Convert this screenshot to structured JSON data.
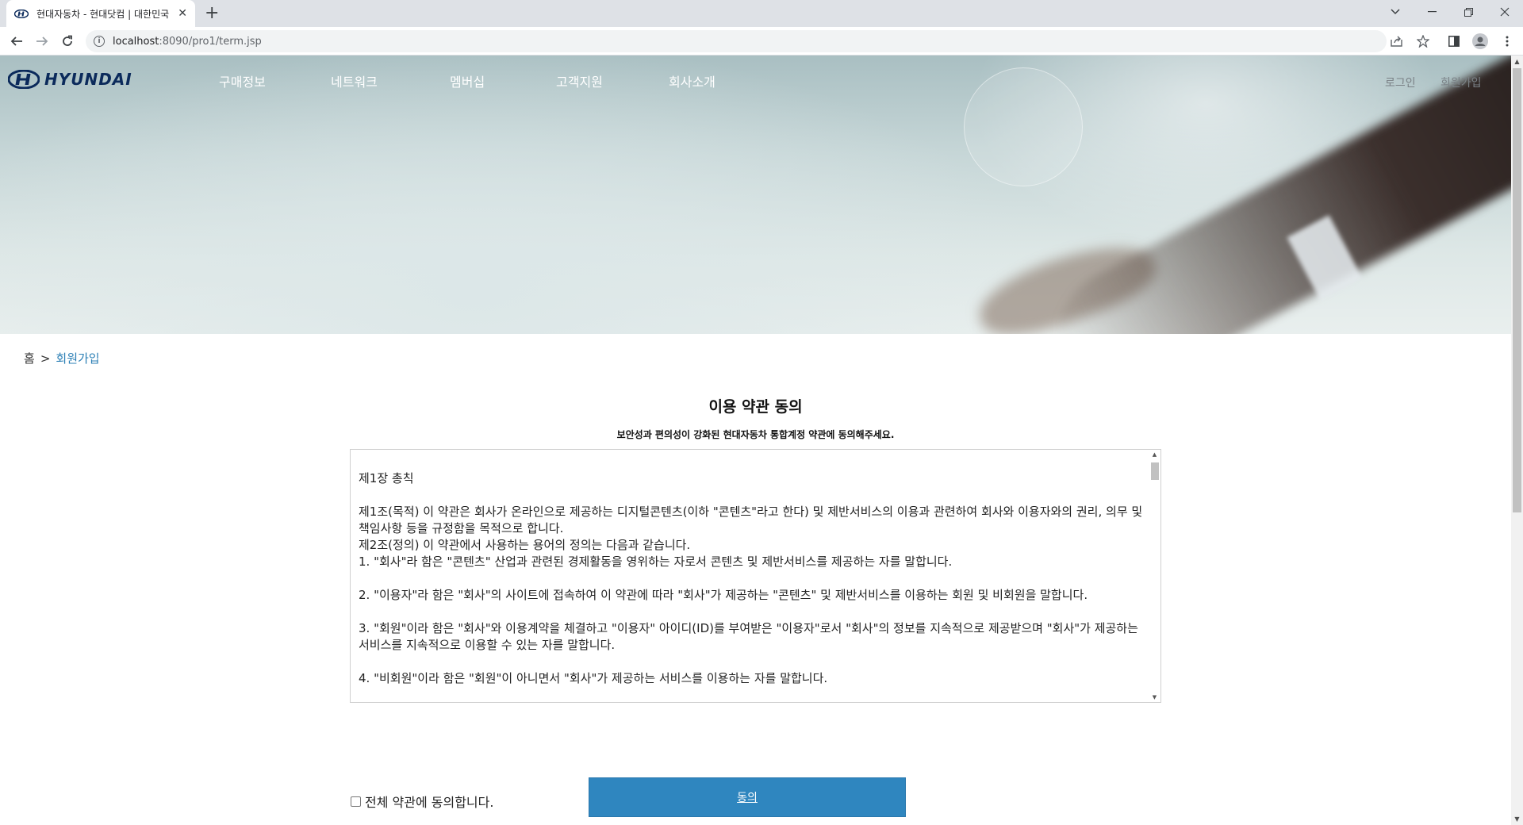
{
  "browser": {
    "tab_title": "현대자동차 - 현대닷컴 | 대한민국",
    "tab_close_glyph": "✕",
    "new_tab_glyph": "+",
    "url_host": "localhost",
    "url_rest": ":8090/pro1/term.jsp"
  },
  "header": {
    "logo_text": "HYUNDAI",
    "nav": [
      "구매정보",
      "네트워크",
      "멤버십",
      "고객지원",
      "회사소개"
    ],
    "login": "로그인",
    "signup": "회원가입"
  },
  "breadcrumb": {
    "home": "홈",
    "separator": ">",
    "current": "회원가입"
  },
  "main": {
    "title": "이용 약관 동의",
    "subtitle": "보안성과 편의성이 강화된 현대자동차 통합계정 약관에 동의해주세요.",
    "terms_text": "제1장 총칙\n\n제1조(목적) 이 약관은 회사가 온라인으로 제공하는 디지털콘텐츠(이하 \"콘텐츠\"라고 한다) 및 제반서비스의 이용과 관련하여 회사와 이용자와의 권리, 의무 및 책임사항 등을 규정함을 목적으로 합니다.\n제2조(정의) 이 약관에서 사용하는 용어의 정의는 다음과 같습니다.\n1. \"회사\"라 함은 \"콘텐츠\" 산업과 관련된 경제활동을 영위하는 자로서 콘텐츠 및 제반서비스를 제공하는 자를 말합니다.\n\n2. \"이용자\"라 함은 \"회사\"의 사이트에 접속하여 이 약관에 따라 \"회사\"가 제공하는 \"콘텐츠\" 및 제반서비스를 이용하는 회원 및 비회원을 말합니다.\n\n3. \"회원\"이라 함은 \"회사\"와 이용계약을 체결하고 \"이용자\" 아이디(ID)를 부여받은 \"이용자\"로서 \"회사\"의 정보를 지속적으로 제공받으며 \"회사\"가 제공하는 서비스를 지속적으로 이용할 수 있는 자를 말합니다.\n\n4. \"비회원\"이라 함은 \"회원\"이 아니면서 \"회사\"가 제공하는 서비스를 이용하는 자를 말합니다.",
    "agree_all_label": "전체 약관에 동의합니다.",
    "agree_all_checked": false,
    "agree_button": "동의"
  },
  "colors": {
    "accent": "#2f86bf",
    "breadcrumb_current": "#2b7fb5",
    "logo": "#0b2a5b"
  }
}
